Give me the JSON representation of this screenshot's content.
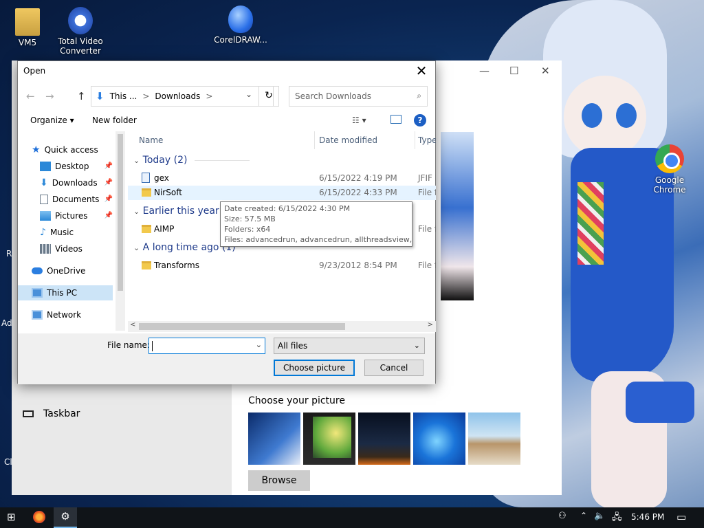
{
  "desktop": {
    "icons": [
      {
        "label": "VM5"
      },
      {
        "label": "Total Video Converter"
      },
      {
        "label": "CorelDRAW..."
      },
      {
        "label": "Google Chrome"
      }
    ],
    "edge_text_left_1": "R",
    "edge_text_left_2": "Ad",
    "edge_text_left_3": "Cl"
  },
  "settings_window": {
    "controls": {
      "minimize": "—",
      "maximize": "☐",
      "close": "✕"
    },
    "sidebar_item": "Taskbar",
    "choose_label": "Choose your picture",
    "browse_label": "Browse",
    "thumbnails": [
      "windows-anime",
      "gex-playstation",
      "night-sky",
      "windows-blue",
      "beach-rocks"
    ]
  },
  "dialog": {
    "title": "Open",
    "close": "✕",
    "address": {
      "back": "←",
      "forward": "→",
      "up": "↑",
      "path": [
        "This ...",
        "Downloads"
      ],
      "separator": ">",
      "dropdown": "⌄",
      "refresh": "↻"
    },
    "search_placeholder": "Search Downloads",
    "toolbar": {
      "organize": "Organize ▾",
      "new_folder": "New folder",
      "view": "☷ ▾",
      "help": "?"
    },
    "nav_items": [
      {
        "label": "Quick access",
        "icon": "star-icon",
        "color": "#1e6fd9"
      },
      {
        "label": "Desktop",
        "icon": "desktop-icon",
        "color": "#2b88d8",
        "pinned": true
      },
      {
        "label": "Downloads",
        "icon": "download-icon",
        "color": "#2b88d8",
        "pinned": true
      },
      {
        "label": "Documents",
        "icon": "document-icon",
        "color": "#6a7a8a",
        "pinned": true
      },
      {
        "label": "Pictures",
        "icon": "picture-icon",
        "color": "#2b88d8",
        "pinned": true
      },
      {
        "label": "Music",
        "icon": "music-icon",
        "color": "#2b88d8"
      },
      {
        "label": "Videos",
        "icon": "video-icon",
        "color": "#6a7a8a"
      },
      {
        "label": "OneDrive",
        "icon": "cloud-icon",
        "color": "#2b7ee0"
      },
      {
        "label": "This PC",
        "icon": "computer-icon",
        "color": "#4a90d9"
      },
      {
        "label": "Network",
        "icon": "network-icon",
        "color": "#4a90d9"
      }
    ],
    "columns": {
      "name": "Name",
      "date": "Date modified",
      "type": "Type"
    },
    "groups": [
      {
        "label": "Today (2)"
      },
      {
        "label": "Earlier this year ("
      },
      {
        "label": "A long time ago (1)"
      }
    ],
    "files": [
      {
        "name": "gex",
        "date": "6/15/2022 4:19 PM",
        "type": "JFIF F",
        "kind": "file"
      },
      {
        "name": "NirSoft",
        "date": "6/15/2022 4:33 PM",
        "type": "File f",
        "kind": "folder"
      },
      {
        "name": "AIMP",
        "date": "",
        "type": "File f",
        "kind": "folder"
      },
      {
        "name": "Transforms",
        "date": "9/23/2012 8:54 PM",
        "type": "File f",
        "kind": "folder"
      }
    ],
    "tooltip": [
      "Date created: 6/15/2022 4:30 PM",
      "Size: 57.5 MB",
      "Folders: x64",
      "Files: advancedrun, advancedrun, allthreadsview, ..."
    ],
    "file_name_label": "File name:",
    "file_name_value": "",
    "filter_value": "All files",
    "choose_button": "Choose picture",
    "cancel_button": "Cancel"
  },
  "taskbar": {
    "start": "⊞",
    "clock": "5:46 PM",
    "notification": "▭"
  }
}
